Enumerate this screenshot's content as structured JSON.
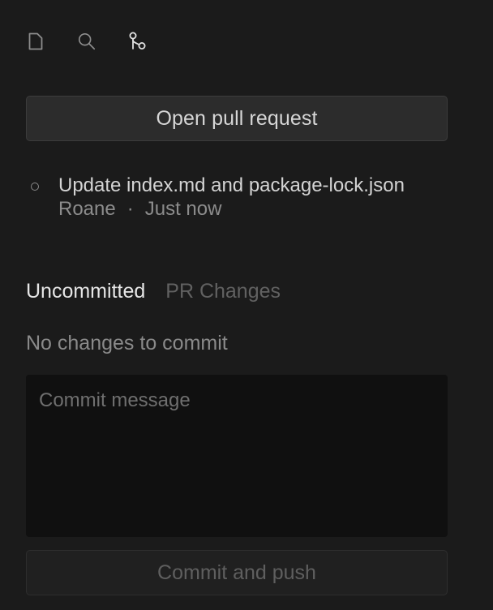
{
  "toolbar": {
    "icons": [
      "file-icon",
      "search-icon",
      "source-control-icon"
    ]
  },
  "pr_button": {
    "label": "Open pull request"
  },
  "commit": {
    "title": "Update index.md and package-lock.json",
    "author": "Roane",
    "separator": "·",
    "time": "Just now"
  },
  "tabs": [
    {
      "label": "Uncommitted",
      "active": true
    },
    {
      "label": "PR Changes",
      "active": false
    }
  ],
  "changes": {
    "empty_text": "No changes to commit"
  },
  "commit_message": {
    "placeholder": "Commit message",
    "value": ""
  },
  "push_button": {
    "label": "Commit and push",
    "disabled": true
  },
  "colors": {
    "background": "#1b1b1b",
    "button": "#2c2c2c",
    "textarea": "#101010",
    "active_tab": "#e6e6e6",
    "inactive_tab": "#616161"
  }
}
